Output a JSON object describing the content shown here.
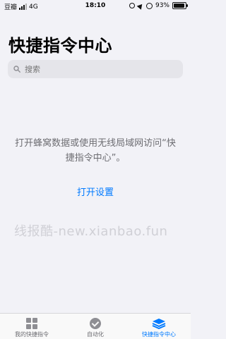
{
  "status_bar": {
    "carrier": "豆瓣",
    "network": "4G",
    "time": "18:10",
    "battery_percent": "93%",
    "battery_level": 0.93
  },
  "header": {
    "title": "快捷指令中心"
  },
  "search": {
    "placeholder": "搜索"
  },
  "message": {
    "text": "打开蜂窝数据或使用无线局域网访问“快捷指令中心”。"
  },
  "actions": {
    "open_settings": "打开设置"
  },
  "watermark": {
    "text": "线报酷-new.xianbao.fun"
  },
  "tab_bar": {
    "tabs": [
      {
        "label": "我的快捷指令",
        "icon": "grid-icon",
        "active": false
      },
      {
        "label": "自动化",
        "icon": "automation-icon",
        "active": false
      },
      {
        "label": "快捷指令中心",
        "icon": "layers-icon",
        "active": true
      }
    ]
  },
  "colors": {
    "accent": "#007aff",
    "background": "#f2f2f7",
    "secondary_text": "#6d6d72"
  }
}
